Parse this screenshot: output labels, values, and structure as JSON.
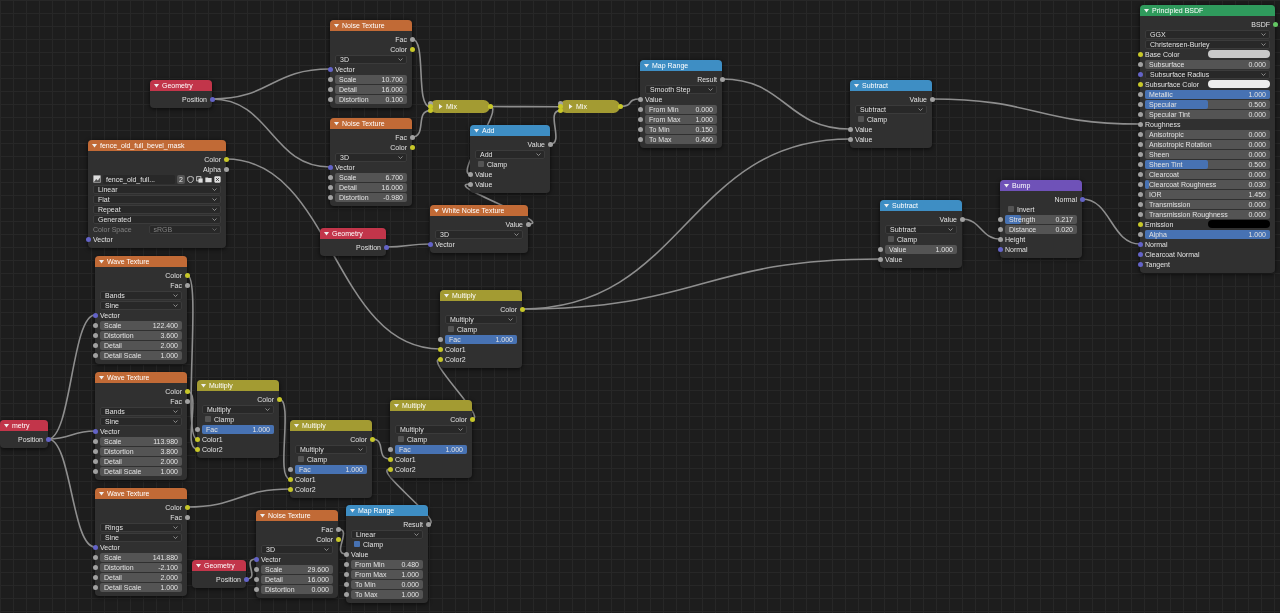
{
  "nodes": [
    {
      "title": "Principled BSDF",
      "color": "#2f9a5c",
      "collapsed": false,
      "rows": [
        {
          "kind": "output",
          "label": "BSDF",
          "socket": {
            "color": "#63c763"
          }
        },
        {
          "kind": "dropdown",
          "value": "GGX"
        },
        {
          "kind": "dropdown",
          "value": "Christensen-Burley"
        },
        {
          "kind": "color",
          "label": "Base Color",
          "color": "#c8c8c8",
          "socket": {
            "color": "#c7c729"
          }
        },
        {
          "kind": "slider",
          "label": "Subsurface",
          "value": "0.000",
          "level": 0,
          "socket": {
            "color": "#a1a1a1"
          }
        },
        {
          "kind": "dropdown",
          "value": "Subsurface Radius",
          "socket": {
            "color": "#6363c7"
          }
        },
        {
          "kind": "color",
          "label": "Subsurface Color",
          "color": "#ececec",
          "socket": {
            "color": "#c7c729"
          }
        },
        {
          "kind": "slider",
          "label": "Metallic",
          "value": "1.000",
          "level": 1,
          "socket": {
            "color": "#a1a1a1"
          }
        },
        {
          "kind": "slider",
          "label": "Specular",
          "value": "0.500",
          "level": 0.5,
          "socket": {
            "color": "#a1a1a1"
          }
        },
        {
          "kind": "slider",
          "label": "Specular Tint",
          "value": "0.000",
          "level": 0,
          "socket": {
            "color": "#a1a1a1"
          }
        },
        {
          "kind": "input",
          "label": "Roughness",
          "socket": {
            "color": "#a1a1a1"
          }
        },
        {
          "kind": "slider",
          "label": "Anisotropic",
          "value": "0.000",
          "level": 0,
          "socket": {
            "color": "#a1a1a1"
          }
        },
        {
          "kind": "slider",
          "label": "Anisotropic Rotation",
          "value": "0.000",
          "level": 0,
          "socket": {
            "color": "#a1a1a1"
          }
        },
        {
          "kind": "slider",
          "label": "Sheen",
          "value": "0.000",
          "level": 0,
          "socket": {
            "color": "#a1a1a1"
          }
        },
        {
          "kind": "slider",
          "label": "Sheen Tint",
          "value": "0.500",
          "level": 0.5,
          "socket": {
            "color": "#a1a1a1"
          }
        },
        {
          "kind": "slider",
          "label": "Clearcoat",
          "value": "0.000",
          "level": 0,
          "socket": {
            "color": "#a1a1a1"
          }
        },
        {
          "kind": "slider",
          "label": "Clearcoat Roughness",
          "value": "0.030",
          "level": 0.03,
          "socket": {
            "color": "#a1a1a1"
          }
        },
        {
          "kind": "field",
          "label": "IOR",
          "value": "1.450",
          "socket": {
            "color": "#a1a1a1"
          }
        },
        {
          "kind": "slider",
          "label": "Transmission",
          "value": "0.000",
          "level": 0,
          "socket": {
            "color": "#a1a1a1"
          }
        },
        {
          "kind": "slider",
          "label": "Transmission Roughness",
          "value": "0.000",
          "level": 0,
          "socket": {
            "color": "#a1a1a1"
          }
        },
        {
          "kind": "color",
          "label": "Emission",
          "color": "#000000",
          "socket": {
            "color": "#c7c729"
          }
        },
        {
          "kind": "slider",
          "label": "Alpha",
          "value": "1.000",
          "level": 1,
          "socket": {
            "color": "#a1a1a1"
          }
        },
        {
          "kind": "input",
          "label": "Normal",
          "socket": {
            "color": "#6363c7"
          }
        },
        {
          "kind": "input",
          "label": "Clearcoat Normal",
          "socket": {
            "color": "#6363c7"
          }
        },
        {
          "kind": "input",
          "label": "Tangent",
          "socket": {
            "color": "#6363c7"
          }
        }
      ]
    },
    {
      "title": "Noise Texture",
      "color": "#c16a36",
      "collapsed": false,
      "rows": [
        {
          "kind": "output",
          "label": "Fac",
          "socket": {
            "color": "#a1a1a1"
          }
        },
        {
          "kind": "output",
          "label": "Color",
          "socket": {
            "color": "#c7c729"
          }
        },
        {
          "kind": "dropdown",
          "value": "3D"
        },
        {
          "kind": "input",
          "label": "Vector",
          "socket": {
            "color": "#6363c7"
          }
        },
        {
          "kind": "field",
          "label": "Scale",
          "value": "10.700",
          "socket": {
            "color": "#a1a1a1"
          }
        },
        {
          "kind": "field",
          "label": "Detail",
          "value": "16.000",
          "socket": {
            "color": "#a1a1a1"
          }
        },
        {
          "kind": "field",
          "label": "Distortion",
          "value": "0.100",
          "socket": {
            "color": "#a1a1a1"
          }
        }
      ]
    },
    {
      "title": "Map Range",
      "color": "#3e8ec4",
      "collapsed": false,
      "rows": [
        {
          "kind": "output",
          "label": "Result",
          "socket": {
            "color": "#a1a1a1"
          }
        },
        {
          "kind": "dropdown",
          "value": "Smooth Step"
        },
        {
          "kind": "input",
          "label": "Value",
          "socket": {
            "color": "#a1a1a1"
          }
        },
        {
          "kind": "field",
          "label": "From Min",
          "value": "0.000",
          "socket": {
            "color": "#a1a1a1"
          }
        },
        {
          "kind": "field",
          "label": "From Max",
          "value": "1.000",
          "socket": {
            "color": "#a1a1a1"
          }
        },
        {
          "kind": "field",
          "label": "To Min",
          "value": "0.150",
          "socket": {
            "color": "#a1a1a1"
          }
        },
        {
          "kind": "field",
          "label": "To Max",
          "value": "0.460",
          "socket": {
            "color": "#a1a1a1"
          }
        }
      ]
    },
    {
      "title": "Geometry",
      "color": "#c2354a",
      "collapsed": false,
      "rows": [
        {
          "kind": "output",
          "label": "Position",
          "socket": {
            "color": "#6363c7"
          }
        }
      ]
    },
    {
      "title": "Subtract",
      "color": "#3e8ec4",
      "collapsed": false,
      "rows": [
        {
          "kind": "output",
          "label": "Value",
          "socket": {
            "color": "#a1a1a1"
          }
        },
        {
          "kind": "dropdown",
          "value": "Subtract"
        },
        {
          "kind": "checkbox",
          "label": "Clamp",
          "checked": false
        },
        {
          "kind": "input",
          "label": "Value",
          "socket": {
            "color": "#a1a1a1"
          }
        },
        {
          "kind": "input",
          "label": "Value",
          "socket": {
            "color": "#a1a1a1"
          }
        }
      ]
    },
    {
      "title": "Mix",
      "color": "#a39b32",
      "collapsed": true,
      "sockets_in": [
        {
          "color": "#a1a1a1"
        },
        {
          "color": "#c7c729"
        },
        {
          "color": "#c7c729"
        }
      ],
      "sockets_out": [
        {
          "color": "#c7c729"
        }
      ]
    },
    {
      "title": "Mix",
      "color": "#a39b32",
      "collapsed": true,
      "sockets_in": [
        {
          "color": "#a1a1a1"
        },
        {
          "color": "#c7c729"
        },
        {
          "color": "#c7c729"
        }
      ],
      "sockets_out": [
        {
          "color": "#c7c729"
        }
      ]
    },
    {
      "title": "Noise Texture",
      "color": "#c16a36",
      "collapsed": false,
      "rows": [
        {
          "kind": "output",
          "label": "Fac",
          "socket": {
            "color": "#a1a1a1"
          }
        },
        {
          "kind": "output",
          "label": "Color",
          "socket": {
            "color": "#c7c729"
          }
        },
        {
          "kind": "dropdown",
          "value": "3D"
        },
        {
          "kind": "input",
          "label": "Vector",
          "socket": {
            "color": "#6363c7"
          }
        },
        {
          "kind": "field",
          "label": "Scale",
          "value": "6.700",
          "socket": {
            "color": "#a1a1a1"
          }
        },
        {
          "kind": "field",
          "label": "Detail",
          "value": "16.000",
          "socket": {
            "color": "#a1a1a1"
          }
        },
        {
          "kind": "field",
          "label": "Distortion",
          "value": "-0.980",
          "socket": {
            "color": "#a1a1a1"
          }
        }
      ]
    },
    {
      "title": "Add",
      "color": "#3e8ec4",
      "collapsed": false,
      "rows": [
        {
          "kind": "output",
          "label": "Value",
          "socket": {
            "color": "#a1a1a1"
          }
        },
        {
          "kind": "dropdown",
          "value": "Add"
        },
        {
          "kind": "checkbox",
          "label": "Clamp",
          "checked": false
        },
        {
          "kind": "input",
          "label": "Value",
          "socket": {
            "color": "#a1a1a1"
          }
        },
        {
          "kind": "input",
          "label": "Value",
          "socket": {
            "color": "#a1a1a1"
          }
        }
      ]
    },
    {
      "title": "fence_old_full_bevel_mask",
      "color": "#c16a36",
      "collapsed": false,
      "rows": [
        {
          "kind": "output",
          "label": "Color",
          "socket": {
            "color": "#c7c729"
          }
        },
        {
          "kind": "output",
          "label": "Alpha",
          "socket": {
            "color": "#a1a1a1"
          }
        },
        {
          "kind": "image",
          "name": "fence_old_full...",
          "users": "2"
        },
        {
          "kind": "dropdown",
          "value": "Linear"
        },
        {
          "kind": "dropdown",
          "value": "Flat"
        },
        {
          "kind": "dropdown",
          "value": "Repeat"
        },
        {
          "kind": "dropdown",
          "value": "Generated"
        },
        {
          "kind": "labeled-dropdown",
          "label": "Color Space",
          "value": "sRGB",
          "disabled": true
        },
        {
          "kind": "input",
          "label": "Vector",
          "socket": {
            "color": "#6363c7"
          }
        }
      ]
    },
    {
      "title": "Bump",
      "color": "#6f52b8",
      "collapsed": false,
      "rows": [
        {
          "kind": "output",
          "label": "Normal",
          "socket": {
            "color": "#6363c7"
          }
        },
        {
          "kind": "checkbox",
          "label": "Invert",
          "checked": false
        },
        {
          "kind": "slider",
          "label": "Strength",
          "value": "0.217",
          "level": 0.217,
          "socket": {
            "color": "#a1a1a1"
          }
        },
        {
          "kind": "field",
          "label": "Distance",
          "value": "0.020",
          "socket": {
            "color": "#a1a1a1"
          }
        },
        {
          "kind": "input",
          "label": "Height",
          "socket": {
            "color": "#a1a1a1"
          }
        },
        {
          "kind": "input",
          "label": "Normal",
          "socket": {
            "color": "#6363c7"
          }
        }
      ]
    },
    {
      "title": "Subtract",
      "color": "#3e8ec4",
      "collapsed": false,
      "rows": [
        {
          "kind": "output",
          "label": "Value",
          "socket": {
            "color": "#a1a1a1"
          }
        },
        {
          "kind": "dropdown",
          "value": "Subtract"
        },
        {
          "kind": "checkbox",
          "label": "Clamp",
          "checked": false
        },
        {
          "kind": "field",
          "label": "Value",
          "value": "1.000",
          "socket": {
            "color": "#a1a1a1"
          }
        },
        {
          "kind": "input",
          "label": "Value",
          "socket": {
            "color": "#a1a1a1"
          }
        }
      ]
    },
    {
      "title": "Geometry",
      "color": "#c2354a",
      "collapsed": false,
      "rows": [
        {
          "kind": "output",
          "label": "Position",
          "socket": {
            "color": "#6363c7"
          }
        }
      ]
    },
    {
      "title": "White Noise Texture",
      "color": "#c16a36",
      "collapsed": false,
      "rows": [
        {
          "kind": "output",
          "label": "Value",
          "socket": {
            "color": "#a1a1a1"
          }
        },
        {
          "kind": "dropdown",
          "value": "3D"
        },
        {
          "kind": "input",
          "label": "Vector",
          "socket": {
            "color": "#6363c7"
          }
        }
      ]
    },
    {
      "title": "Wave Texture",
      "color": "#c16a36",
      "collapsed": false,
      "rows": [
        {
          "kind": "output",
          "label": "Color",
          "socket": {
            "color": "#c7c729"
          }
        },
        {
          "kind": "output",
          "label": "Fac",
          "socket": {
            "color": "#a1a1a1"
          }
        },
        {
          "kind": "dropdown",
          "value": "Bands"
        },
        {
          "kind": "dropdown",
          "value": "Sine"
        },
        {
          "kind": "input",
          "label": "Vector",
          "socket": {
            "color": "#6363c7"
          }
        },
        {
          "kind": "field",
          "label": "Scale",
          "value": "122.400",
          "socket": {
            "color": "#a1a1a1"
          }
        },
        {
          "kind": "field",
          "label": "Distortion",
          "value": "3.600",
          "socket": {
            "color": "#a1a1a1"
          }
        },
        {
          "kind": "field",
          "label": "Detail",
          "value": "2.000",
          "socket": {
            "color": "#a1a1a1"
          }
        },
        {
          "kind": "field",
          "label": "Detail Scale",
          "value": "1.000",
          "socket": {
            "color": "#a1a1a1"
          }
        }
      ]
    },
    {
      "title": "Multiply",
      "color": "#a39b32",
      "collapsed": false,
      "rows": [
        {
          "kind": "output",
          "label": "Color",
          "socket": {
            "color": "#c7c729"
          }
        },
        {
          "kind": "dropdown",
          "value": "Multiply"
        },
        {
          "kind": "checkbox",
          "label": "Clamp",
          "checked": false
        },
        {
          "kind": "slider",
          "label": "Fac",
          "value": "1.000",
          "level": 1,
          "socket": {
            "color": "#a1a1a1"
          }
        },
        {
          "kind": "input",
          "label": "Color1",
          "socket": {
            "color": "#c7c729"
          }
        },
        {
          "kind": "input",
          "label": "Color2",
          "socket": {
            "color": "#c7c729"
          }
        }
      ]
    },
    {
      "title": "Wave Texture",
      "color": "#c16a36",
      "collapsed": false,
      "rows": [
        {
          "kind": "output",
          "label": "Color",
          "socket": {
            "color": "#c7c729"
          }
        },
        {
          "kind": "output",
          "label": "Fac",
          "socket": {
            "color": "#a1a1a1"
          }
        },
        {
          "kind": "dropdown",
          "value": "Bands"
        },
        {
          "kind": "dropdown",
          "value": "Sine"
        },
        {
          "kind": "input",
          "label": "Vector",
          "socket": {
            "color": "#6363c7"
          }
        },
        {
          "kind": "field",
          "label": "Scale",
          "value": "113.980",
          "socket": {
            "color": "#a1a1a1"
          }
        },
        {
          "kind": "field",
          "label": "Distortion",
          "value": "3.800",
          "socket": {
            "color": "#a1a1a1"
          }
        },
        {
          "kind": "field",
          "label": "Detail",
          "value": "2.000",
          "socket": {
            "color": "#a1a1a1"
          }
        },
        {
          "kind": "field",
          "label": "Detail Scale",
          "value": "1.000",
          "socket": {
            "color": "#a1a1a1"
          }
        }
      ]
    },
    {
      "title": "Multiply",
      "color": "#a39b32",
      "collapsed": false,
      "rows": [
        {
          "kind": "output",
          "label": "Color",
          "socket": {
            "color": "#c7c729"
          }
        },
        {
          "kind": "dropdown",
          "value": "Multiply"
        },
        {
          "kind": "checkbox",
          "label": "Clamp",
          "checked": false
        },
        {
          "kind": "slider",
          "label": "Fac",
          "value": "1.000",
          "level": 1,
          "socket": {
            "color": "#a1a1a1"
          }
        },
        {
          "kind": "input",
          "label": "Color1",
          "socket": {
            "color": "#c7c729"
          }
        },
        {
          "kind": "input",
          "label": "Color2",
          "socket": {
            "color": "#c7c729"
          }
        }
      ]
    },
    {
      "title": "Multiply",
      "color": "#a39b32",
      "collapsed": false,
      "rows": [
        {
          "kind": "output",
          "label": "Color",
          "socket": {
            "color": "#c7c729"
          }
        },
        {
          "kind": "dropdown",
          "value": "Multiply"
        },
        {
          "kind": "checkbox",
          "label": "Clamp",
          "checked": false
        },
        {
          "kind": "slider",
          "label": "Fac",
          "value": "1.000",
          "level": 1,
          "socket": {
            "color": "#a1a1a1"
          }
        },
        {
          "kind": "input",
          "label": "Color1",
          "socket": {
            "color": "#c7c729"
          }
        },
        {
          "kind": "input",
          "label": "Color2",
          "socket": {
            "color": "#c7c729"
          }
        }
      ]
    },
    {
      "title": "metry",
      "color": "#c2354a",
      "collapsed": false,
      "rows": [
        {
          "kind": "output",
          "label": "Position",
          "socket": {
            "color": "#6363c7"
          }
        }
      ]
    },
    {
      "title": "Multiply",
      "color": "#a39b32",
      "collapsed": false,
      "rows": [
        {
          "kind": "output",
          "label": "Color",
          "socket": {
            "color": "#c7c729"
          }
        },
        {
          "kind": "dropdown",
          "value": "Multiply"
        },
        {
          "kind": "checkbox",
          "label": "Clamp",
          "checked": false
        },
        {
          "kind": "slider",
          "label": "Fac",
          "value": "1.000",
          "level": 1,
          "socket": {
            "color": "#a1a1a1"
          }
        },
        {
          "kind": "input",
          "label": "Color1",
          "socket": {
            "color": "#c7c729"
          }
        },
        {
          "kind": "input",
          "label": "Color2",
          "socket": {
            "color": "#c7c729"
          }
        }
      ]
    },
    {
      "title": "Wave Texture",
      "color": "#c16a36",
      "collapsed": false,
      "rows": [
        {
          "kind": "output",
          "label": "Color",
          "socket": {
            "color": "#c7c729"
          }
        },
        {
          "kind": "output",
          "label": "Fac",
          "socket": {
            "color": "#a1a1a1"
          }
        },
        {
          "kind": "dropdown",
          "value": "Rings"
        },
        {
          "kind": "dropdown",
          "value": "Sine"
        },
        {
          "kind": "input",
          "label": "Vector",
          "socket": {
            "color": "#6363c7"
          }
        },
        {
          "kind": "field",
          "label": "Scale",
          "value": "141.880",
          "socket": {
            "color": "#a1a1a1"
          }
        },
        {
          "kind": "field",
          "label": "Distortion",
          "value": "-2.100",
          "socket": {
            "color": "#a1a1a1"
          }
        },
        {
          "kind": "field",
          "label": "Detail",
          "value": "2.000",
          "socket": {
            "color": "#a1a1a1"
          }
        },
        {
          "kind": "field",
          "label": "Detail Scale",
          "value": "1.000",
          "socket": {
            "color": "#a1a1a1"
          }
        }
      ]
    },
    {
      "title": "Noise Texture",
      "color": "#c16a36",
      "collapsed": false,
      "rows": [
        {
          "kind": "output",
          "label": "Fac",
          "socket": {
            "color": "#a1a1a1"
          }
        },
        {
          "kind": "output",
          "label": "Color",
          "socket": {
            "color": "#c7c729"
          }
        },
        {
          "kind": "dropdown",
          "value": "3D"
        },
        {
          "kind": "input",
          "label": "Vector",
          "socket": {
            "color": "#6363c7"
          }
        },
        {
          "kind": "field",
          "label": "Scale",
          "value": "29.600",
          "socket": {
            "color": "#a1a1a1"
          }
        },
        {
          "kind": "field",
          "label": "Detail",
          "value": "16.000",
          "socket": {
            "color": "#a1a1a1"
          }
        },
        {
          "kind": "field",
          "label": "Distortion",
          "value": "0.000",
          "socket": {
            "color": "#a1a1a1"
          }
        }
      ]
    },
    {
      "title": "Map Range",
      "color": "#3e8ec4",
      "collapsed": false,
      "rows": [
        {
          "kind": "output",
          "label": "Result",
          "socket": {
            "color": "#a1a1a1"
          }
        },
        {
          "kind": "dropdown",
          "value": "Linear"
        },
        {
          "kind": "checkbox",
          "label": "Clamp",
          "checked": true
        },
        {
          "kind": "input",
          "label": "Value",
          "socket": {
            "color": "#a1a1a1"
          }
        },
        {
          "kind": "field",
          "label": "From Min",
          "value": "0.480",
          "socket": {
            "color": "#a1a1a1"
          }
        },
        {
          "kind": "field",
          "label": "From Max",
          "value": "1.000",
          "socket": {
            "color": "#a1a1a1"
          }
        },
        {
          "kind": "field",
          "label": "To Min",
          "value": "0.000",
          "socket": {
            "color": "#a1a1a1"
          }
        },
        {
          "kind": "field",
          "label": "To Max",
          "value": "1.000",
          "socket": {
            "color": "#a1a1a1"
          }
        }
      ]
    },
    {
      "title": "Geometry",
      "color": "#c2354a",
      "collapsed": false,
      "rows": [
        {
          "kind": "output",
          "label": "Position",
          "socket": {
            "color": "#6363c7"
          }
        }
      ]
    }
  ]
}
